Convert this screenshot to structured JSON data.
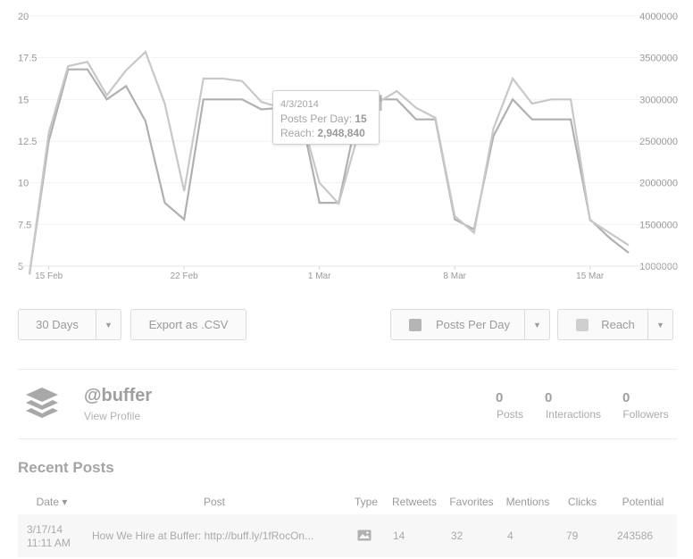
{
  "chart_data": {
    "type": "line",
    "x": [
      "14 Feb",
      "15 Feb",
      "16 Feb",
      "17 Feb",
      "18 Feb",
      "19 Feb",
      "20 Feb",
      "21 Feb",
      "22 Feb",
      "23 Feb",
      "24 Feb",
      "25 Feb",
      "26 Feb",
      "27 Feb",
      "28 Feb",
      "1 Mar",
      "2 Mar",
      "3 Mar",
      "4 Mar",
      "5 Mar",
      "6 Mar",
      "7 Mar",
      "8 Mar",
      "9 Mar",
      "10 Mar",
      "11 Mar",
      "12 Mar",
      "13 Mar",
      "14 Mar",
      "15 Mar",
      "16 Mar",
      "17 Mar"
    ],
    "x_tick_labels": [
      "15 Feb",
      "22 Feb",
      "1 Mar",
      "8 Mar",
      "15 Mar"
    ],
    "y_left_ticks": [
      "5",
      "7.5",
      "10",
      "12.5",
      "15",
      "17.5",
      "20"
    ],
    "y_right_ticks": [
      "1000000",
      "1500000",
      "2000000",
      "2500000",
      "3000000",
      "3500000",
      "4000000"
    ],
    "ylim_left": [
      5,
      20
    ],
    "ylim_right": [
      1000000,
      4000000
    ],
    "series": [
      {
        "name": "Posts Per Day",
        "axis": "left",
        "values": [
          4.5,
          12.5,
          16.8,
          16.8,
          15,
          15.8,
          13.7,
          8.8,
          7.8,
          15,
          15,
          15,
          14.4,
          14.5,
          14.3,
          8.8,
          8.8,
          14.3,
          15,
          15,
          13.8,
          13.8,
          7.8,
          7.2,
          12.8,
          15,
          13.8,
          13.8,
          13.8,
          7.8,
          6.7,
          5.8
        ]
      },
      {
        "name": "Reach",
        "axis": "right",
        "values": [
          900000,
          2600000,
          3400000,
          3450000,
          3050000,
          3350000,
          3570000,
          2950000,
          1900000,
          3250000,
          3250000,
          3220000,
          2970000,
          2900000,
          2850000,
          2000000,
          1750000,
          2580000,
          2960000,
          3100000,
          2900000,
          2780000,
          1600000,
          1400000,
          2650000,
          3250000,
          2950000,
          3000000,
          3000000,
          1550000,
          1400000,
          1250000
        ]
      }
    ],
    "tooltip": {
      "date": "4/3/2014",
      "posts_label": "Posts Per Day:",
      "posts_value": "15",
      "reach_label": "Reach:",
      "reach_value": "2,948,840"
    },
    "colors": {
      "posts": "#b0b0b0",
      "reach": "#c8c8c8",
      "grid": "#f2f2f2"
    }
  },
  "controls": {
    "range": "30 Days",
    "export": "Export as .CSV",
    "metric_1": "Posts Per Day",
    "metric_2": "Reach",
    "caret": "▼"
  },
  "profile": {
    "handle": "@buffer",
    "view_profile": "View Profile",
    "stats": [
      {
        "value": "0",
        "label": "Posts"
      },
      {
        "value": "0",
        "label": "Interactions"
      },
      {
        "value": "0",
        "label": "Followers"
      }
    ]
  },
  "recent_posts": {
    "title": "Recent Posts",
    "columns": [
      "Date ▾",
      "Post",
      "Type",
      "Retweets",
      "Favorites",
      "Mentions",
      "Clicks",
      "Potential"
    ],
    "rows": [
      {
        "date": "3/17/14",
        "time": "11:11 AM",
        "post": "How We Hire at Buffer: http://buff.ly/1fRocOn...",
        "type_icon": "image-icon",
        "retweets": "14",
        "favorites": "32",
        "mentions": "4",
        "clicks": "79",
        "potential": "243586"
      }
    ]
  }
}
